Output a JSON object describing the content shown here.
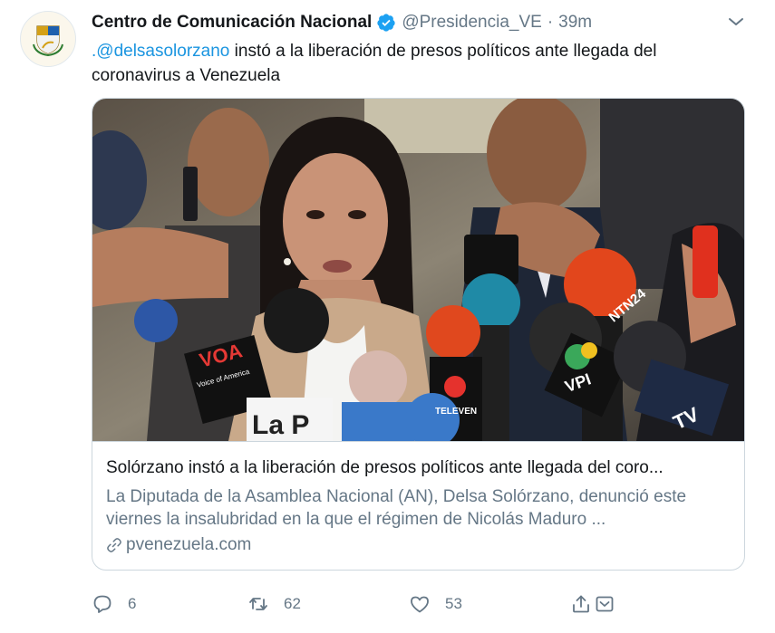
{
  "tweet": {
    "display_name": "Centro de Comunicación Nacional",
    "handle": "@Presidencia_VE",
    "separator": "·",
    "time": "39m",
    "text_mention": ".@delsasolorzano",
    "text_body": " instó a la liberación de presos políticos ante llegada del coronavirus a Venezuela"
  },
  "card": {
    "title": "Solórzano instó a la liberación de presos políticos ante llegada del coro...",
    "description": "La Diputada de la Asamblea Nacional (AN), Delsa Solórzano, denunció este viernes la insalubridad en la que el régimen de Nicolás Maduro ...",
    "domain": "pvenezuela.com",
    "mic_labels": {
      "voa": "VOA",
      "voa_sub": "Voice of America",
      "lapatilla": "La P",
      "televen": "TELEVEN",
      "vpi": "VPI",
      "ntn24": "NTN24",
      "vtv": "TV"
    }
  },
  "actions": {
    "replies": "6",
    "retweets": "62",
    "likes": "53"
  },
  "colors": {
    "link": "#1b95e0",
    "verified": "#1da1f2",
    "secondary": "#657786"
  },
  "icons": [
    "venezuela-coat-of-arms-icon",
    "verified-badge-icon",
    "chevron-down-icon",
    "reply-icon",
    "retweet-icon",
    "like-icon",
    "share-icon",
    "link-icon"
  ]
}
